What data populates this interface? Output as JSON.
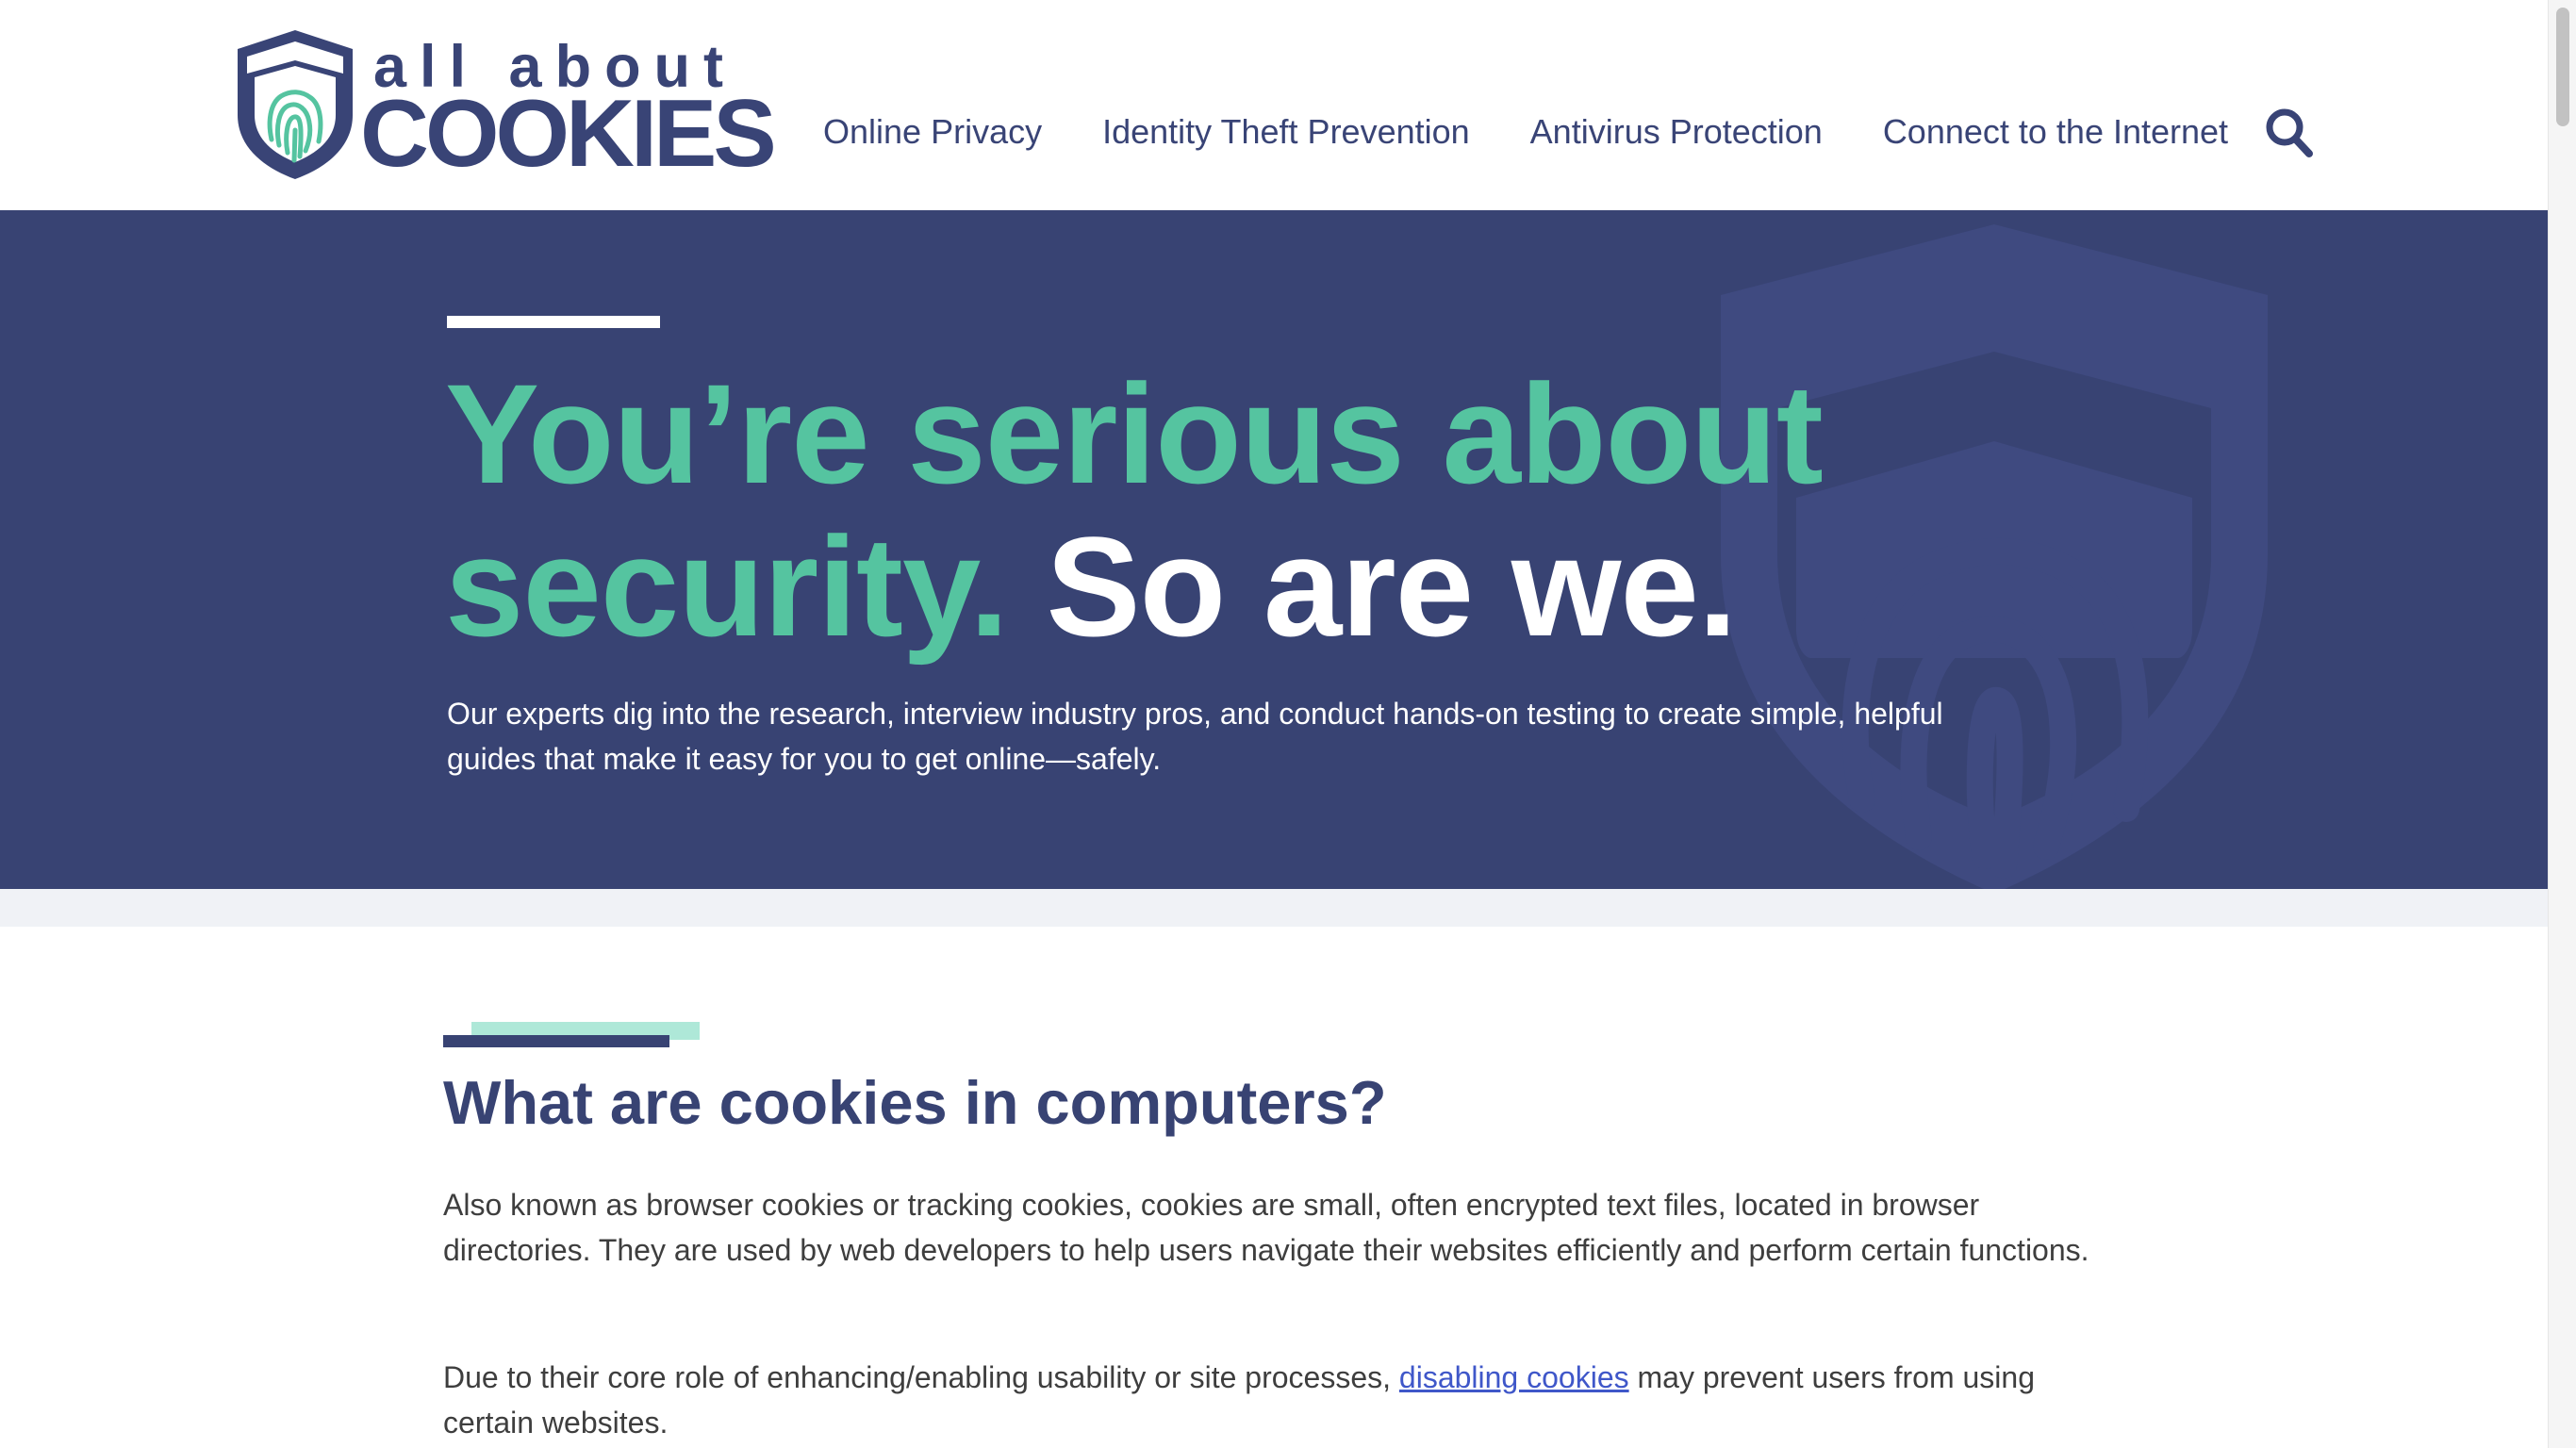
{
  "logo": {
    "line1": "all about",
    "line2": "COOKIES"
  },
  "nav": {
    "items": [
      "Online Privacy",
      "Identity Theft Prevention",
      "Antivirus Protection",
      "Connect to the Internet"
    ],
    "search_icon": "search-icon"
  },
  "hero": {
    "title_accent_line1": "You’re serious about",
    "title_accent_line2": "security.",
    "title_white": "So are we.",
    "description": "Our experts dig into the research, interview industry pros, and conduct hands-on testing to create simple, helpful guides that make it easy for you to get online—safely.",
    "watermark_icon": "shield-fingerprint-icon"
  },
  "article": {
    "heading": "What are cookies in computers?",
    "para1": "Also known as browser cookies or tracking cookies, cookies are small, often encrypted text files, located in browser directories. They are used by web developers to help users navigate their websites efficiently and perform certain functions.",
    "para2_before": "Due to their core role of enhancing/enabling usability or site processes, ",
    "para2_link": "disabling cookies",
    "para2_after": " may prevent users from using certain websites."
  },
  "colors": {
    "navy": "#384373",
    "brand_text": "#394476",
    "accent_green": "#55c4a0",
    "light_teal": "#aee8d8",
    "link_blue": "#3f57c9",
    "strip_gray": "#f0f2f6"
  }
}
